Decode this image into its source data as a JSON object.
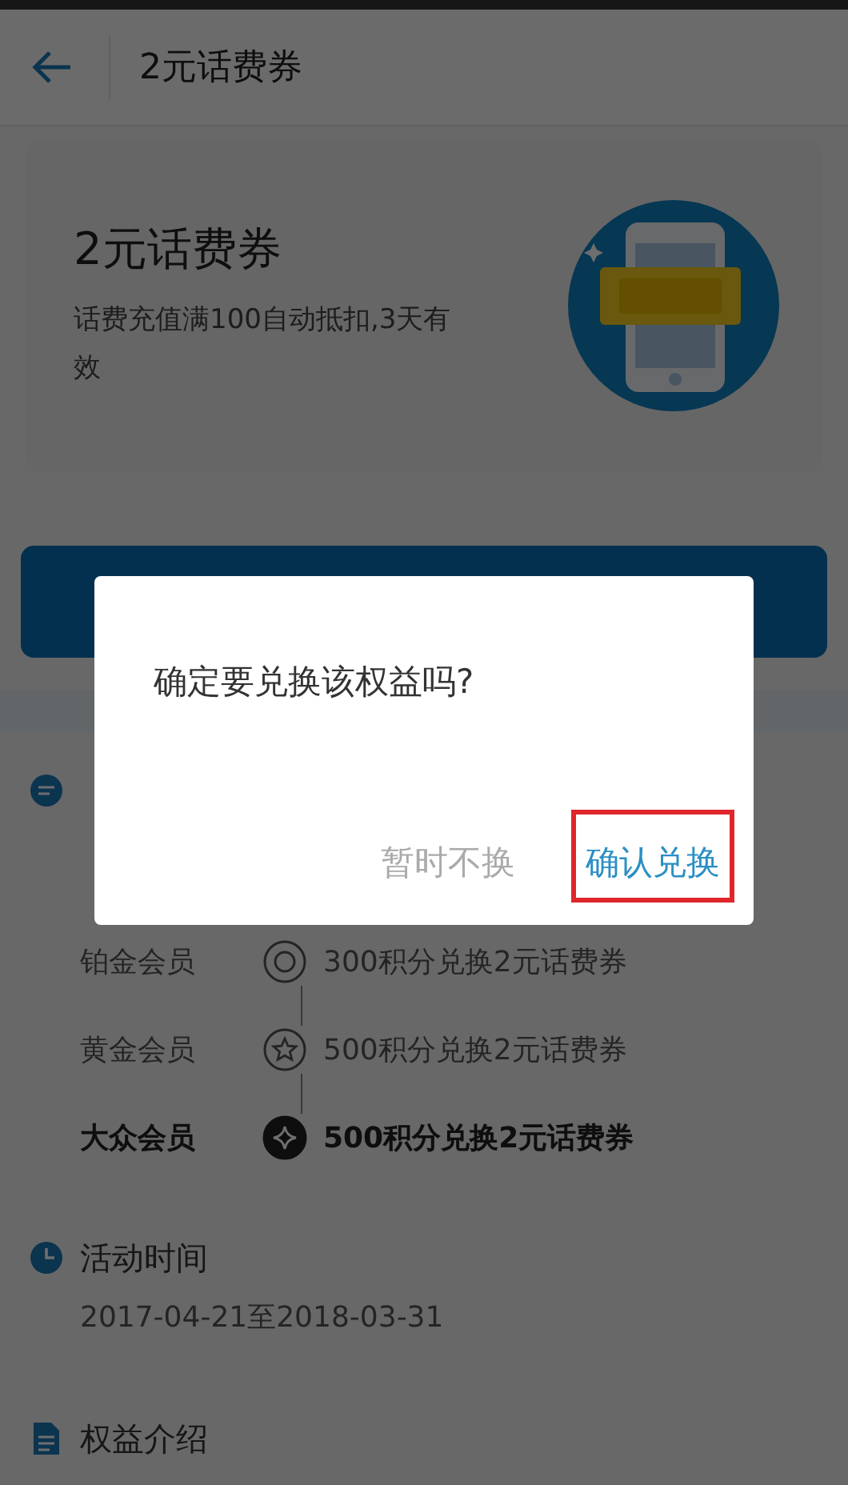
{
  "header": {
    "title": "2元话费券"
  },
  "coupon": {
    "title": "2元话费券",
    "description": "话费充值满100自动抵扣,3天有效"
  },
  "tiers": [
    {
      "name": "铂金会员",
      "kind": "ring",
      "benefit": "300积分兑换2元话费券",
      "current": false
    },
    {
      "name": "黄金会员",
      "kind": "star",
      "benefit": "500积分兑换2元话费券",
      "current": false
    },
    {
      "name": "大众会员",
      "kind": "diamond",
      "benefit": "500积分兑换2元话费券",
      "current": true
    }
  ],
  "activity": {
    "title": "活动时间",
    "dates": "2017-04-21至2018-03-31"
  },
  "intro": {
    "title": "权益介绍"
  },
  "dialog": {
    "message": "确定要兑换该权益吗?",
    "buttons": [
      {
        "label": "暂时不换",
        "kind": "cancel",
        "highlighted": false
      },
      {
        "label": "确认兑换",
        "kind": "confirm",
        "highlighted": true
      }
    ]
  }
}
